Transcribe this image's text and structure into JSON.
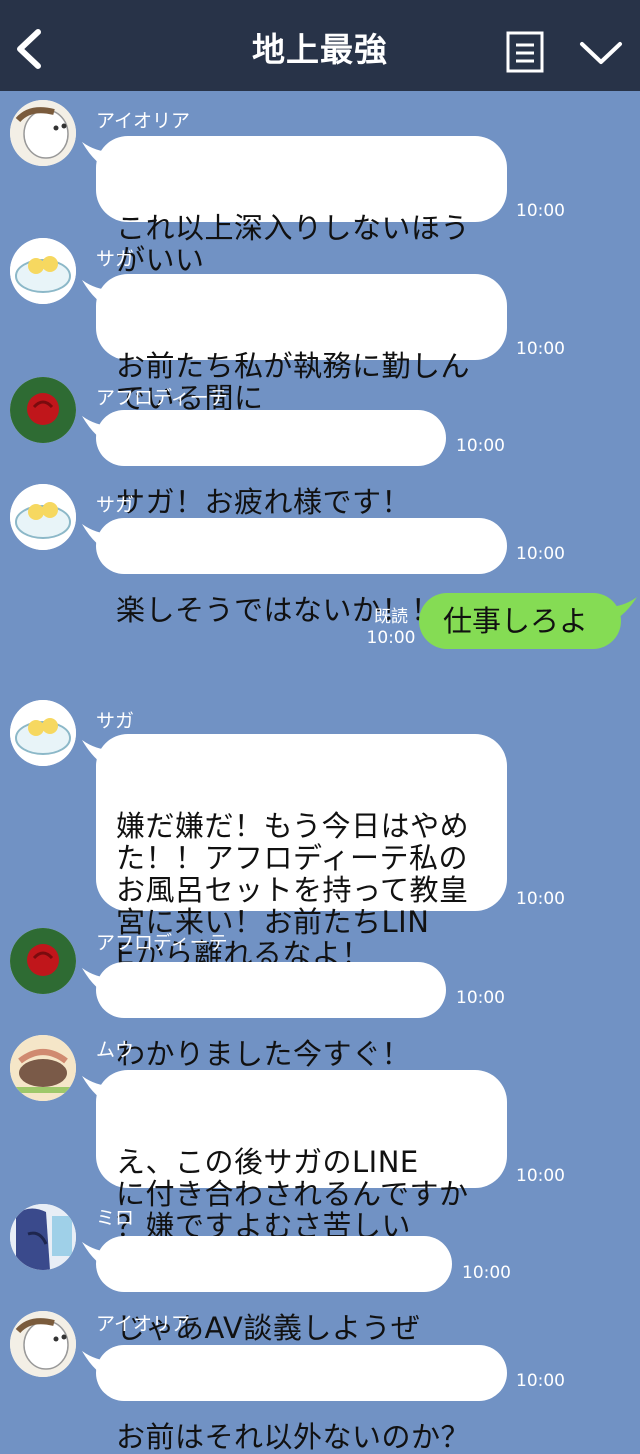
{
  "header": {
    "title": "地上最強",
    "back_icon": "chevron-left-icon",
    "menu_icon": "notes-icon",
    "collapse_icon": "chevron-down-icon"
  },
  "colors": {
    "header_bg": "#283348",
    "chat_bg": "#7192c4",
    "incoming_bubble": "#ffffff",
    "outgoing_bubble": "#85dc54"
  },
  "messages": [
    {
      "sender": "アイオリア",
      "text": "これ以上深入りしないほう\nがいい",
      "time": "10:00"
    },
    {
      "sender": "サガ",
      "text": "お前たち私が執務に勤しん\nでいる間に",
      "time": "10:00"
    },
    {
      "sender": "アフロディーテ",
      "text": "サガ！お疲れ様です！",
      "time": "10:00"
    },
    {
      "sender": "サガ",
      "text": "楽しそうではないか！！！",
      "time": "10:00"
    },
    {
      "sender": "サガ",
      "text": "嫌だ嫌だ！もう今日はやめ\nた！！アフロディーテ私の\nお風呂セットを持って教皇\n宮に来い！お前たちLIN\nEから離れるなよ！",
      "time": "10:00"
    },
    {
      "sender": "アフロディーテ",
      "text": "わかりました今すぐ！",
      "time": "10:00"
    },
    {
      "sender": "ムウ",
      "text": "え、この後サガのLINE\nに付き合わされるんですか\n？嫌ですよむさ苦しい",
      "time": "10:00"
    },
    {
      "sender": "ミロ",
      "text": "じゃあAV談義しようぜ",
      "time": "10:00"
    },
    {
      "sender": "アイオリア",
      "text": "お前はそれ以外ないのか？",
      "time": "10:00"
    }
  ],
  "my_message": {
    "text": "仕事しろよ",
    "read_label": "既読",
    "time": "10:00"
  }
}
